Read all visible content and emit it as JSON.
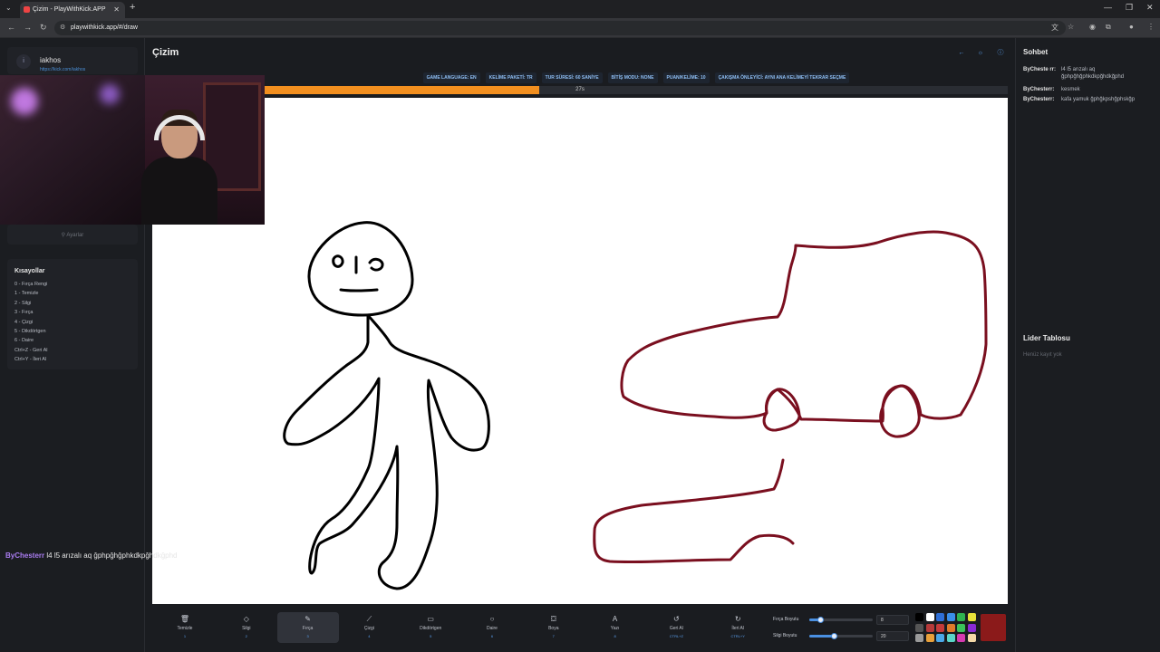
{
  "browser": {
    "tab_title": "Çizim - PlayWithKick.APP",
    "url": "playwithkick.app/#/draw"
  },
  "sidebar": {
    "user_avatar": "i",
    "user_name": "iakhos",
    "user_link": "https://kick.com/iakhos",
    "settings_label": "Ayarlar",
    "shortcuts_title": "Kısayollar",
    "shortcuts": [
      "0 - Fırça Rengi",
      "1 - Temizle",
      "2 - Silgi",
      "3 - Fırça",
      "4 - Çizgi",
      "5 - Dikdörtgen",
      "6 - Daire",
      "Ctrl+Z - Geri Al",
      "Ctrl+Y - İleri Al"
    ]
  },
  "main": {
    "title": "Çizim",
    "settings_chips": [
      "GAME LANGUAGE: EN",
      "KELİME PAKETİ: TR",
      "TUR SÜRESİ: 60 SANİYE",
      "BİTİŞ MODU: NONE",
      "PUAN/KELİME: 10",
      "ÇAKIŞMA ÖNLEYİCİ: AYNI ANA KELİMEYİ TEKRAR SEÇME"
    ],
    "timer_text": "27s",
    "timer_fraction": 0.37,
    "brush_color": "#7a0f1f",
    "accent_color": "#f28f1f"
  },
  "toolbar": {
    "tools": [
      {
        "label": "Temizle",
        "key": "1",
        "icon": "trash-icon",
        "glyph": "🗑"
      },
      {
        "label": "Silgi",
        "key": "2",
        "icon": "eraser-icon",
        "glyph": "◇"
      },
      {
        "label": "Fırça",
        "key": "3",
        "icon": "brush-icon",
        "glyph": "✎"
      },
      {
        "label": "Çizgi",
        "key": "4",
        "icon": "line-icon",
        "glyph": "⟋"
      },
      {
        "label": "Dikdörtgen",
        "key": "5",
        "icon": "rectangle-icon",
        "glyph": "▭"
      },
      {
        "label": "Daire",
        "key": "6",
        "icon": "circle-icon",
        "glyph": "○"
      },
      {
        "label": "Boya",
        "key": "7",
        "icon": "bucket-icon",
        "glyph": "⛋"
      },
      {
        "label": "Yazı",
        "key": "8",
        "icon": "text-icon",
        "glyph": "A"
      },
      {
        "label": "Geri Al",
        "key": "CTRL+Z",
        "icon": "undo-icon",
        "glyph": "↺"
      },
      {
        "label": "İleri Al",
        "key": "CTRL+Y",
        "icon": "redo-icon",
        "glyph": "↻"
      }
    ],
    "active_tool": "Fırça",
    "brush_size_label": "Fırça Boyutu",
    "brush_size": "8",
    "eraser_size_label": "Silgi Boyutu",
    "eraser_size": "20",
    "palette": [
      "#000000",
      "#ffffff",
      "#2f6fd6",
      "#3a8ee8",
      "#2fb34f",
      "#e8e23a",
      "#555555",
      "#b53a3a",
      "#c43a3a",
      "#e07a2a",
      "#3ac45a",
      "#8a2ad6",
      "#9a9a9a",
      "#e8a03a",
      "#4aa8e8",
      "#5ad6c8",
      "#d63ab0",
      "#f4d8a8"
    ],
    "current_color": "#8b1a1a"
  },
  "chat": {
    "title": "Sohbet",
    "messages": [
      {
        "user": "ByCheste rr:",
        "text": "l4 l5 arızalı aq ğphpğhğphkdkpğhdkğphd"
      },
      {
        "user": "ByChesterr:",
        "text": "kesmek"
      },
      {
        "user": "ByChesterr:",
        "text": "kafa yamuk ğphğkpshğphskğp"
      }
    ]
  },
  "leaderboard": {
    "title": "Lider Tablosu",
    "empty_text": "Henüz kayıt yok"
  },
  "overlay_chat": {
    "user": "ByChesterr",
    "text": "l4 l5 arızalı aq ğphpğhğphkdkpğhdkğphd"
  }
}
